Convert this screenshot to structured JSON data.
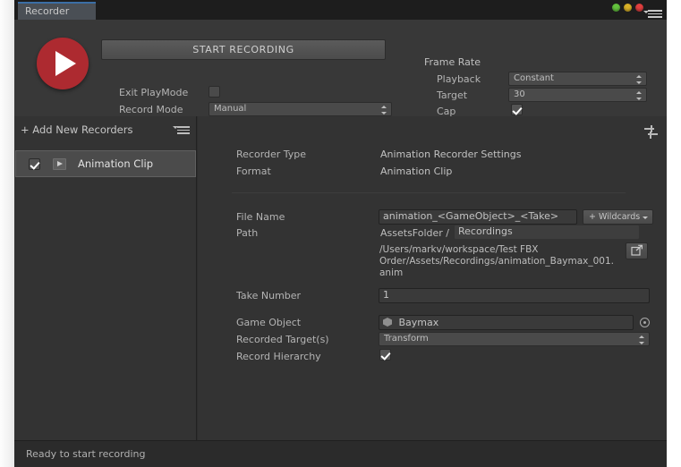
{
  "window": {
    "tab_label": "Recorder",
    "controls": {
      "green": "#63c13e",
      "yellow": "#d8b028",
      "red": "#e03f3f",
      "menu_icon": "hamburger-menu-icon"
    }
  },
  "top": {
    "record_button_icon": "play-record-icon",
    "start_recording_label": "START RECORDING",
    "exit_playmode_label": "Exit PlayMode",
    "exit_playmode_checked": false,
    "record_mode_label": "Record Mode",
    "record_mode_value": "Manual",
    "frame_rate": {
      "title": "Frame Rate",
      "playback_label": "Playback",
      "playback_value": "Constant",
      "target_label": "Target",
      "target_value": "30",
      "cap_label": "Cap",
      "cap_checked": true
    }
  },
  "sidebar": {
    "add_new_label": "+ Add New Recorders",
    "menu_icon": "list-menu-icon",
    "items": [
      {
        "label": "Animation Clip",
        "enabled": true,
        "icon": "animation-clip-icon",
        "selected": true
      }
    ]
  },
  "settings": {
    "preset_icon": "preset-sliders-icon",
    "recorder_type_label": "Recorder Type",
    "recorder_type_value": "Animation Recorder Settings",
    "format_label": "Format",
    "format_value": "Animation Clip",
    "file_name_label": "File Name",
    "file_name_value": "animation_<GameObject>_<Take>",
    "wildcards_label": "+ Wildcards",
    "path_label": "Path",
    "path_root_value": "AssetsFolder  /",
    "path_folder_value": "Recordings",
    "resolved_path": "/Users/markv/workspace/Test FBX Order/Assets/Recordings/animation_Baymax_001.anim",
    "browse_icon": "open-external-icon",
    "take_number_label": "Take Number",
    "take_number_value": "1",
    "game_object_label": "Game Object",
    "game_object_value": "Baymax",
    "game_object_icon": "prefab-cube-icon",
    "game_object_picker_icon": "target-select-icon",
    "recorded_targets_label": "Recorded Target(s)",
    "recorded_targets_value": "Transform",
    "record_hierarchy_label": "Record Hierarchy",
    "record_hierarchy_checked": true
  },
  "status": {
    "message": "Ready to start recording"
  }
}
